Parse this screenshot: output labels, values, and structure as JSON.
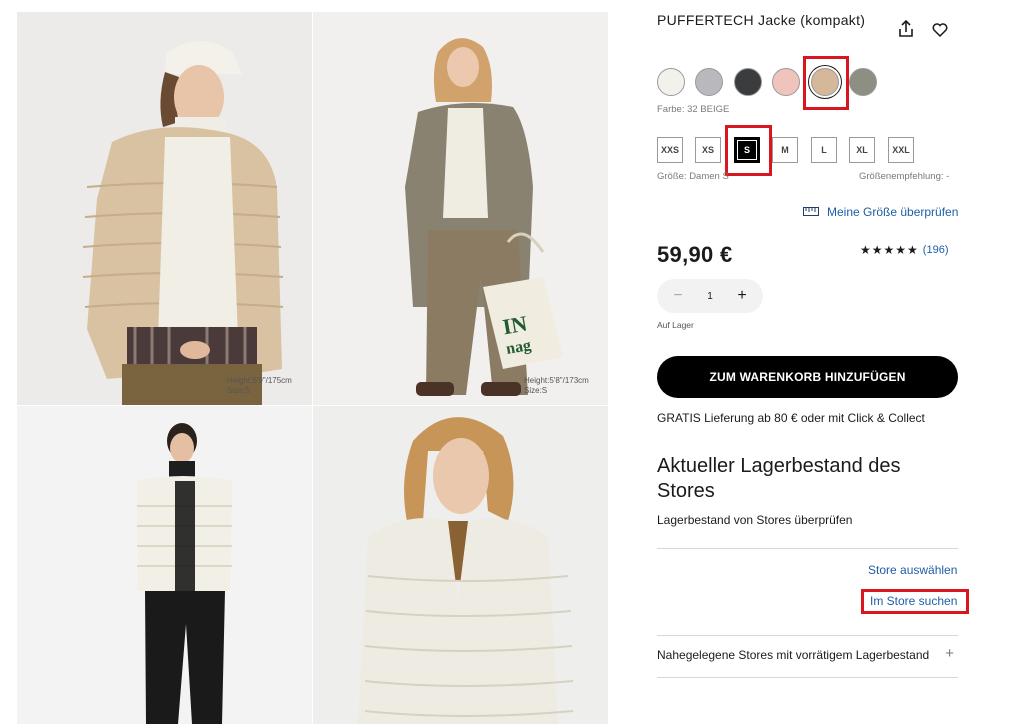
{
  "product": {
    "title": "PUFFERTECH Jacke (kompakt)",
    "color_label": "Farbe: 32 BEIGE",
    "size_label": "Größe: Damen S",
    "size_recommendation": "Größenempfehlung: -",
    "check_size_link": "Meine Größe überprüfen",
    "price": "59,90 €",
    "rating_stars": "★★★★★",
    "rating_count": "(196)",
    "quantity": "1",
    "stock_status": "Auf Lager",
    "add_to_cart": "ZUM WARENKORB HINZUFÜGEN",
    "delivery_note": "GRATIS Lieferung ab 80 € oder mit Click & Collect"
  },
  "colors": [
    {
      "hex": "#f3f1ec"
    },
    {
      "hex": "#b9b8bd"
    },
    {
      "hex": "#3b3c3e"
    },
    {
      "hex": "#f1c3bd"
    },
    {
      "hex": "#d5b79a",
      "selected": true
    },
    {
      "hex": "#8d8f82"
    }
  ],
  "sizes": [
    "XXS",
    "XS",
    "S",
    "M",
    "L",
    "XL",
    "XXL"
  ],
  "selected_size": "S",
  "store": {
    "heading": "Aktueller Lagerbestand des Stores",
    "subheading": "Lagerbestand von Stores überprüfen",
    "select_store": "Store auswählen",
    "search_in_store": "Im Store suchen",
    "nearby_stores": "Nahegelegene Stores mit vorrätigem Lagerbestand"
  },
  "gallery": [
    {
      "caption_line1": "Height:5'9\"/175cm",
      "caption_line2": "Size:S"
    },
    {
      "caption_line1": "Height:5'8\"/173cm",
      "caption_line2": "Size:S"
    },
    {},
    {}
  ],
  "bag_text": "IN nag",
  "accent": {
    "highlight": "#d7161f",
    "link": "#1e5ea6"
  }
}
